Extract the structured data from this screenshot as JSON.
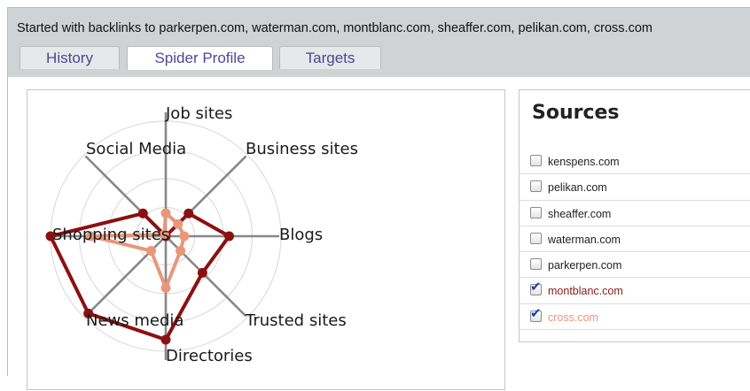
{
  "header": {
    "text": "Started with backlinks to parkerpen.com, waterman.com, montblanc.com, sheaffer.com, pelikan.com, cross.com"
  },
  "tabs": [
    {
      "label": "History",
      "active": false
    },
    {
      "label": "Spider Profile",
      "active": true
    },
    {
      "label": "Targets",
      "active": false
    }
  ],
  "sources": {
    "title": "Sources",
    "items": [
      {
        "label": "kenspens.com",
        "checked": false,
        "color": "#222222"
      },
      {
        "label": "pelikan.com",
        "checked": false,
        "color": "#222222"
      },
      {
        "label": "sheaffer.com",
        "checked": false,
        "color": "#222222"
      },
      {
        "label": "waterman.com",
        "checked": false,
        "color": "#222222"
      },
      {
        "label": "parkerpen.com",
        "checked": false,
        "color": "#222222"
      },
      {
        "label": "montblanc.com",
        "checked": true,
        "color": "#8b1a1a"
      },
      {
        "label": "cross.com",
        "checked": true,
        "color": "#e8977a"
      }
    ]
  },
  "chart_data": {
    "type": "radar",
    "axes": [
      "Job sites",
      "Business sites",
      "Blogs",
      "Trusted sites",
      "Directories",
      "News media",
      "Shopping sites",
      "Social Media"
    ],
    "rings": 4,
    "max": 1,
    "series": [
      {
        "name": "montblanc.com",
        "color": "#8b1010",
        "values": [
          0.0,
          0.28,
          0.55,
          0.45,
          0.9,
          0.95,
          1.0,
          0.28
        ]
      },
      {
        "name": "cross.com",
        "color": "#e8977a",
        "values": [
          0.2,
          0.15,
          0.16,
          0.18,
          0.45,
          0.18,
          0.65,
          0.02
        ]
      }
    ]
  },
  "colors": {
    "tab_text": "#4c4797",
    "header_bg": "#cfd3d4",
    "axis": "#888888",
    "ring": "#dddddd"
  }
}
